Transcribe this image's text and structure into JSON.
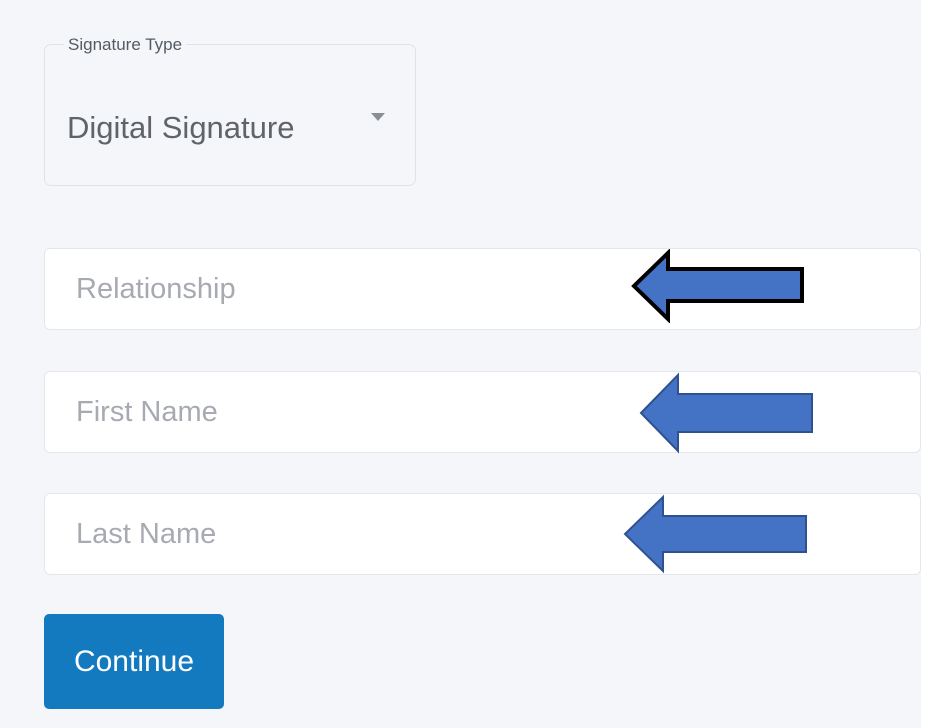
{
  "form": {
    "signature_type": {
      "label": "Signature Type",
      "selected_value": "Digital Signature"
    },
    "relationship": {
      "value": "",
      "placeholder": "Relationship"
    },
    "first_name": {
      "value": "",
      "placeholder": "First Name"
    },
    "last_name": {
      "value": "",
      "placeholder": "Last Name"
    },
    "continue_label": "Continue"
  },
  "colors": {
    "panel_background": "#f4f6f9",
    "button": "#137ac0",
    "arrow_fill": "#4472c4",
    "arrow_outline_dark": "#000000",
    "arrow_outline_blue": "#2f528f"
  },
  "annotations": {
    "arrows": [
      {
        "icon": "left-arrow-icon",
        "points_to": "relationship"
      },
      {
        "icon": "left-arrow-icon",
        "points_to": "first-name"
      },
      {
        "icon": "left-arrow-icon",
        "points_to": "last-name"
      }
    ]
  }
}
